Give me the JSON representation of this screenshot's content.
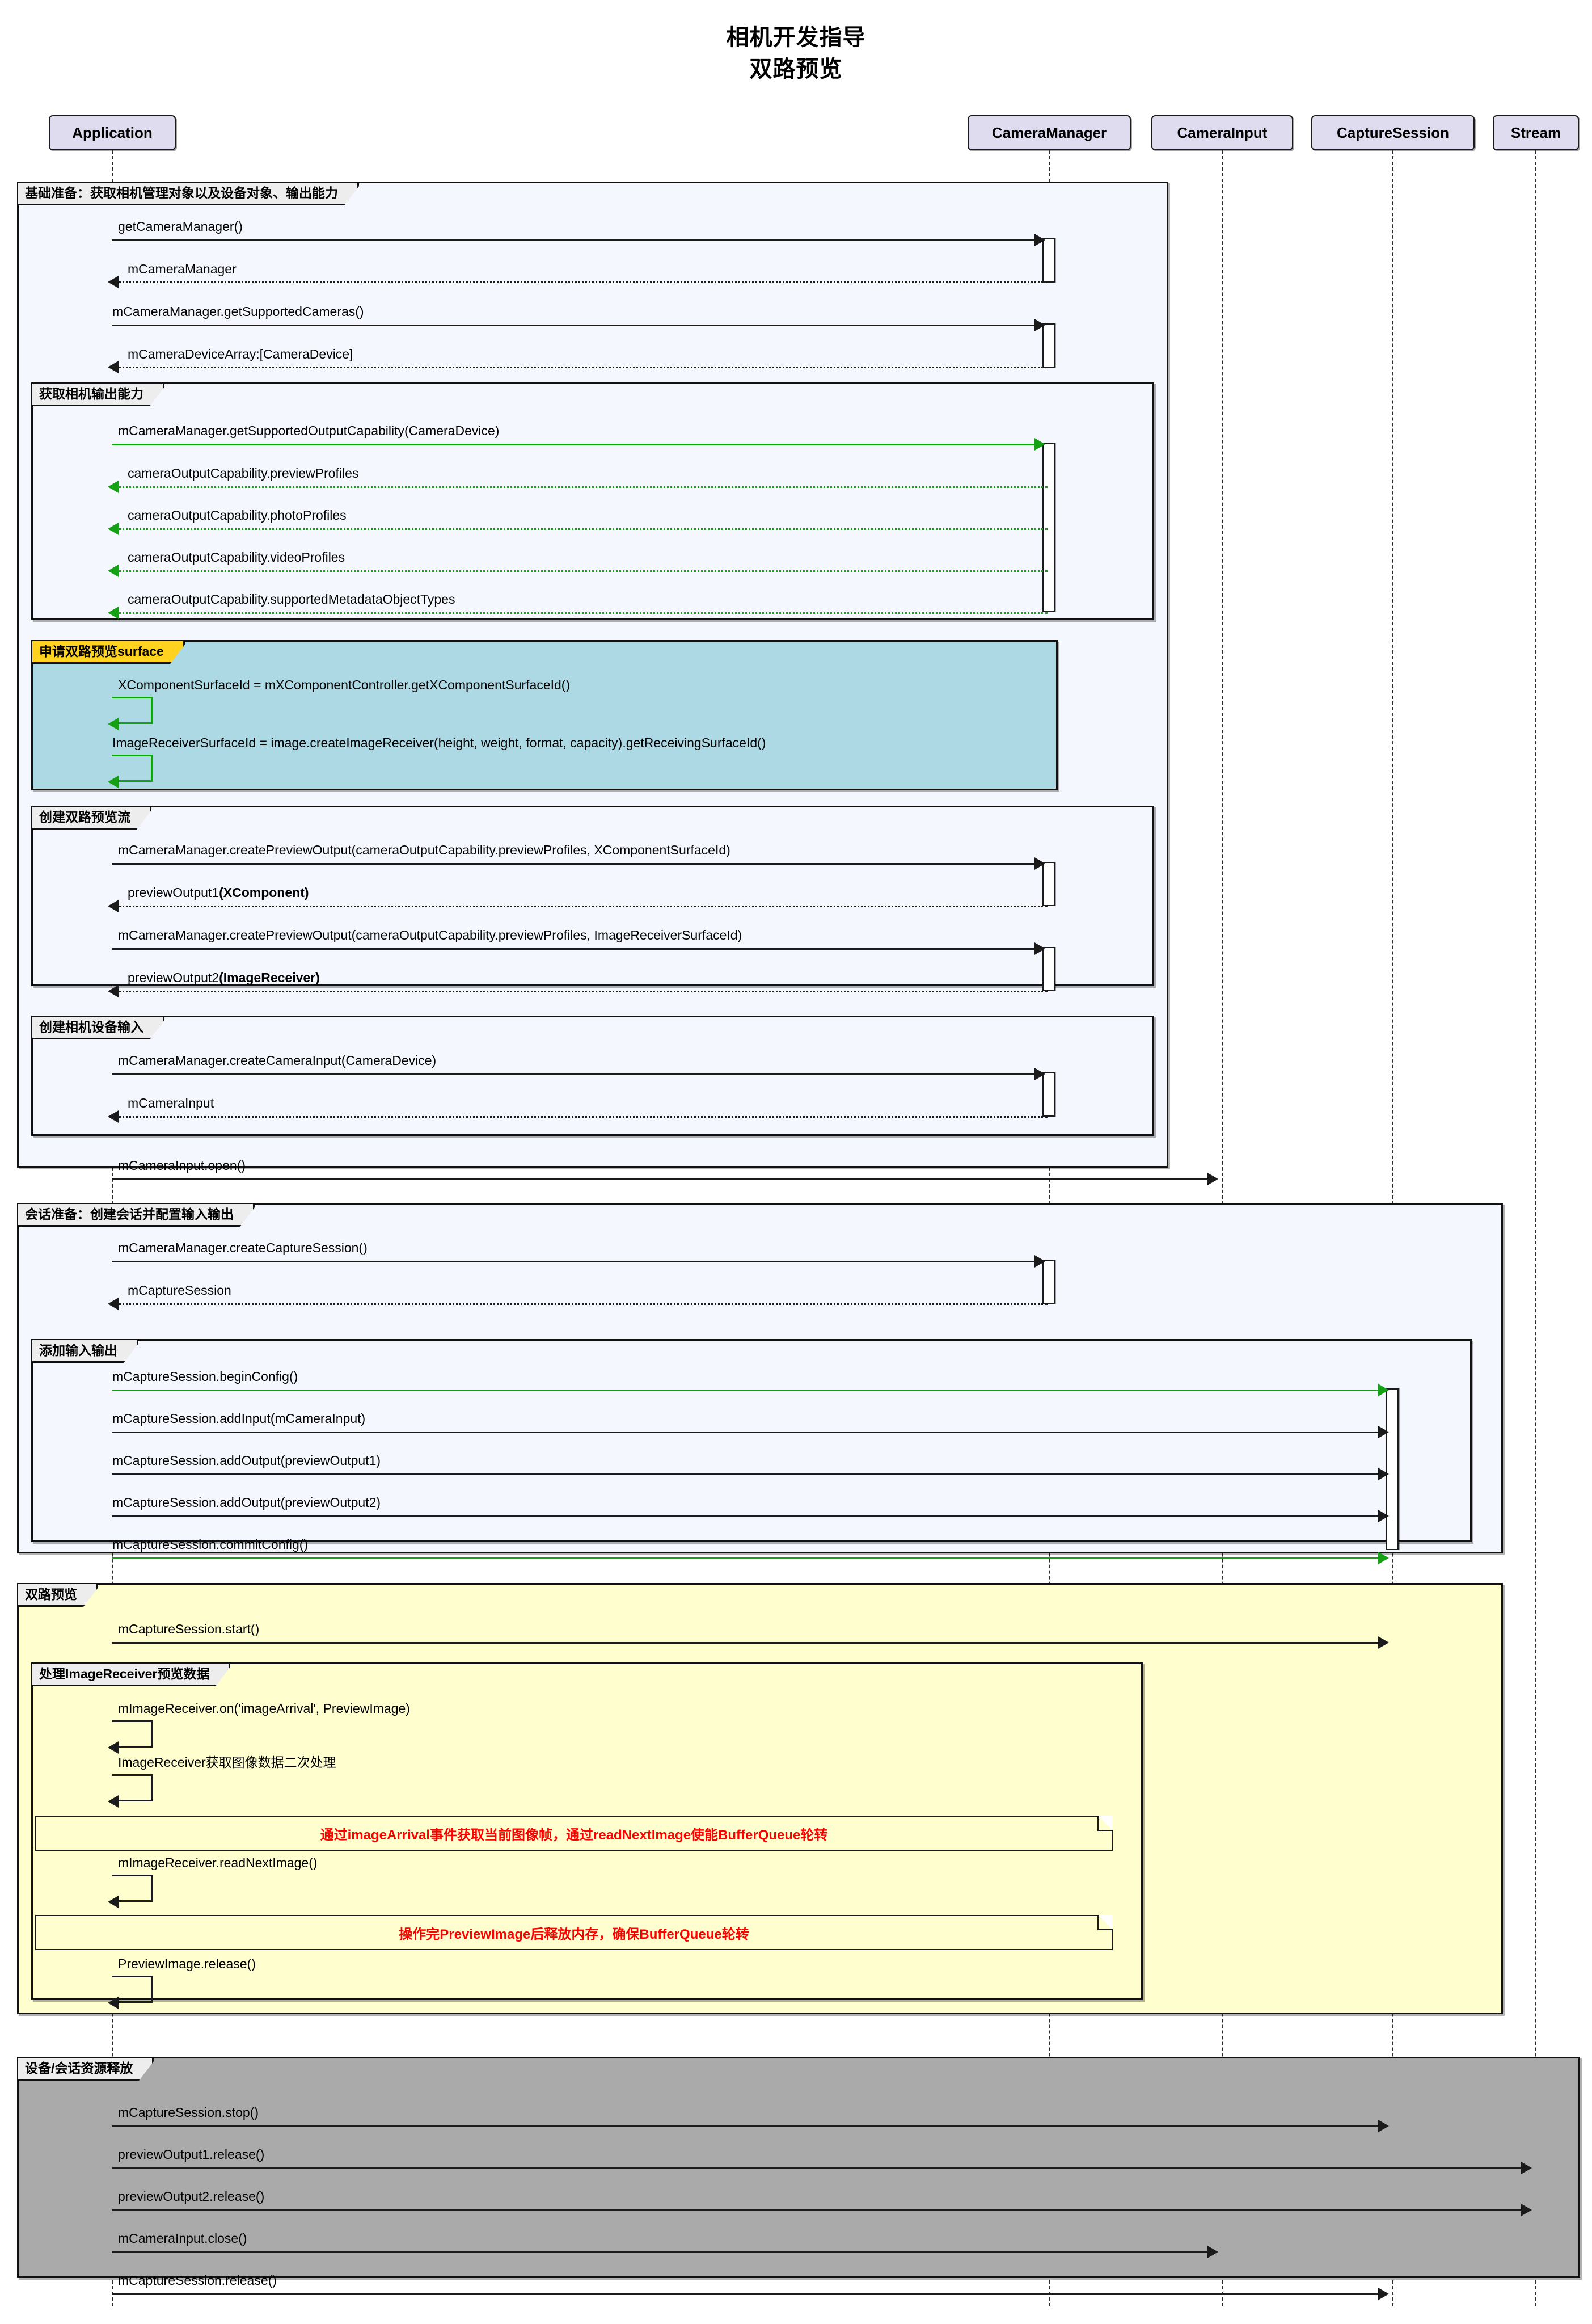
{
  "title": {
    "line1": "相机开发指导",
    "line2": "双路预览"
  },
  "participants": [
    {
      "name": "Application"
    },
    {
      "name": "CameraManager"
    },
    {
      "name": "CameraInput"
    },
    {
      "name": "CaptureSession"
    },
    {
      "name": "Stream"
    }
  ],
  "fragments": [
    {
      "label": "基础准备：获取相机管理对象以及设备对象、输出能力"
    },
    {
      "label": "获取相机输出能力"
    },
    {
      "label": "申请双路预览surface"
    },
    {
      "label": "创建双路预览流"
    },
    {
      "label": "创建相机设备输入"
    },
    {
      "label": "会话准备：创建会话并配置输入输出"
    },
    {
      "label": "添加输入输出"
    },
    {
      "label": "双路预览"
    },
    {
      "label": "处理ImageReceiver预览数据"
    },
    {
      "label": "设备/会话资源释放"
    }
  ],
  "messages": [
    {
      "id": "m1",
      "text": "getCameraManager()"
    },
    {
      "id": "m2",
      "text": "mCameraManager"
    },
    {
      "id": "m3",
      "text": "mCameraManager.getSupportedCameras()"
    },
    {
      "id": "m4",
      "text": "mCameraDeviceArray:[CameraDevice]"
    },
    {
      "id": "m5",
      "text": "mCameraManager.getSupportedOutputCapability(CameraDevice)"
    },
    {
      "id": "m6",
      "text": "cameraOutputCapability.previewProfiles"
    },
    {
      "id": "m7",
      "text": "cameraOutputCapability.photoProfiles"
    },
    {
      "id": "m8",
      "text": "cameraOutputCapability.videoProfiles"
    },
    {
      "id": "m9",
      "text": "cameraOutputCapability.supportedMetadataObjectTypes"
    },
    {
      "id": "m10",
      "text": "XComponentSurfaceId = mXComponentController.getXComponentSurfaceId()"
    },
    {
      "id": "m11",
      "text": "ImageReceiverSurfaceId = image.createImageReceiver(height, weight, format, capacity).getReceivingSurfaceId()"
    },
    {
      "id": "m12",
      "text": "mCameraManager.createPreviewOutput(cameraOutputCapability.previewProfiles, XComponentSurfaceId)"
    },
    {
      "id": "m13",
      "text": "previewOutput1",
      "bold": "(XComponent)"
    },
    {
      "id": "m14",
      "text": "mCameraManager.createPreviewOutput(cameraOutputCapability.previewProfiles, ImageReceiverSurfaceId)"
    },
    {
      "id": "m15",
      "text": "previewOutput2",
      "bold": "(ImageReceiver)"
    },
    {
      "id": "m16",
      "text": "mCameraManager.createCameraInput(CameraDevice)"
    },
    {
      "id": "m17",
      "text": "mCameraInput"
    },
    {
      "id": "m18",
      "text": "mCameraInput.open()"
    },
    {
      "id": "m19",
      "text": "mCameraManager.createCaptureSession()"
    },
    {
      "id": "m20",
      "text": "mCaptureSession"
    },
    {
      "id": "m21",
      "text": "mCaptureSession.beginConfig()"
    },
    {
      "id": "m22",
      "text": "mCaptureSession.addInput(mCameraInput)"
    },
    {
      "id": "m23",
      "text": "mCaptureSession.addOutput(previewOutput1)"
    },
    {
      "id": "m24",
      "text": "mCaptureSession.addOutput(previewOutput2)"
    },
    {
      "id": "m25",
      "text": "mCaptureSession.commitConfig()"
    },
    {
      "id": "m26",
      "text": "mCaptureSession.start()"
    },
    {
      "id": "m27",
      "text": "mImageReceiver.on('imageArrival', PreviewImage)"
    },
    {
      "id": "m28",
      "text": "ImageReceiver获取图像数据二次处理"
    },
    {
      "id": "m29",
      "text": "mImageReceiver.readNextImage()"
    },
    {
      "id": "m30",
      "text": "PreviewImage.release()"
    },
    {
      "id": "m31",
      "text": "mCaptureSession.stop()"
    },
    {
      "id": "m32",
      "text": "previewOutput1.release()"
    },
    {
      "id": "m33",
      "text": "previewOutput2.release()"
    },
    {
      "id": "m34",
      "text": "mCameraInput.close()"
    },
    {
      "id": "m35",
      "text": "mCaptureSession.release()"
    }
  ],
  "notes": [
    {
      "id": "n1",
      "text": "通过imageArrival事件获取当前图像帧，通过readNextImage使能BufferQueue轮转"
    },
    {
      "id": "n2",
      "text": "操作完PreviewImage后释放内存，确保BufferQueue轮转"
    }
  ],
  "colors": {
    "participant_fill": "#DEDCEE",
    "fragment_blue": "#F4F7FE",
    "fragment_teal": "#ADD9E4",
    "fragment_yellow": "#FEFECE",
    "fragment_gray": "#AAAAAA",
    "label_gold": "#FFD21F",
    "note_text_red": "#FF0000",
    "arrow_green": "#16A016",
    "arrow_black": "#1B1B1B"
  }
}
